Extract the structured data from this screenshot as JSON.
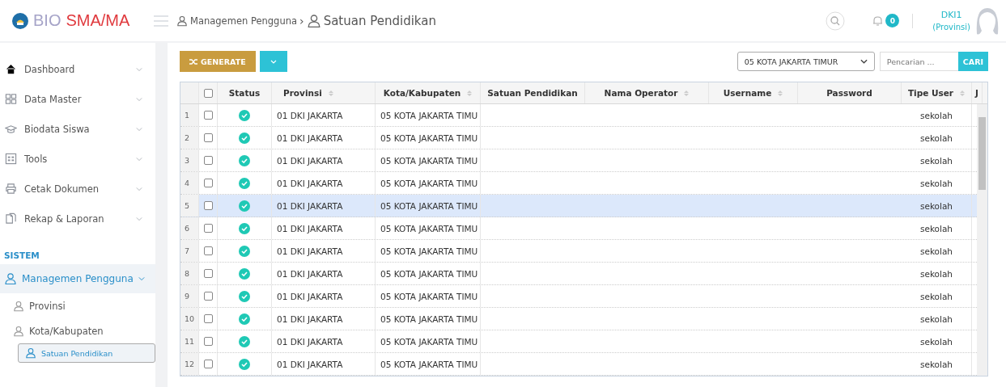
{
  "header": {
    "logo": {
      "part1": "BIO",
      "part2": "SMA/MA"
    },
    "breadcrumb": [
      {
        "label": "Managemen Pengguna"
      },
      {
        "label": "Satuan Pendidikan"
      }
    ],
    "breadcrumb_separator": "›",
    "notifications": "0",
    "user": {
      "name": "DKI1",
      "role": "(Provinsi)"
    }
  },
  "sidebar": {
    "items": [
      {
        "label": "Dashboard",
        "kind": "home"
      },
      {
        "label": "Data Master",
        "kind": "grid"
      },
      {
        "label": "Biodata Siswa",
        "kind": "cap"
      },
      {
        "label": "Tools",
        "kind": "tools"
      },
      {
        "label": "Cetak Dokumen",
        "kind": "printer"
      },
      {
        "label": "Rekap & Laporan",
        "kind": "report"
      }
    ],
    "section": "SISTEM",
    "group": {
      "label": "Managemen Pengguna",
      "expanded": true,
      "children": [
        {
          "label": "Provinsi",
          "selected": false
        },
        {
          "label": "Kota/Kabupaten",
          "selected": false
        },
        {
          "label": "Satuan Pendidikan",
          "selected": true
        }
      ]
    }
  },
  "toolbar": {
    "generate": "GENERATE",
    "filter": "05 KOTA JAKARTA TIMUR",
    "search_placeholder": "Pencarian ...",
    "search_button": "CARI"
  },
  "table": {
    "header_checked": false,
    "columns": [
      {
        "label": "Status",
        "sortable": false
      },
      {
        "label": "Provinsi",
        "sortable": true
      },
      {
        "label": "Kota/Kabupaten",
        "sortable": true
      },
      {
        "label": "Satuan Pendidikan",
        "sortable": false
      },
      {
        "label": "Nama Operator",
        "sortable": true
      },
      {
        "label": "Username",
        "sortable": true
      },
      {
        "label": "Password",
        "sortable": false
      },
      {
        "label": "Tipe User",
        "sortable": true
      },
      {
        "label": "J",
        "sortable": false
      }
    ],
    "rows": [
      {
        "number": "1",
        "checked": false,
        "active": true,
        "provinsi": "01 DKI JAKARTA",
        "kota": "05 KOTA JAKARTA TIMU",
        "tipe_user": "sekolah",
        "selected": false
      },
      {
        "number": "2",
        "checked": false,
        "active": true,
        "provinsi": "01 DKI JAKARTA",
        "kota": "05 KOTA JAKARTA TIMU",
        "tipe_user": "sekolah",
        "selected": false
      },
      {
        "number": "3",
        "checked": false,
        "active": true,
        "provinsi": "01 DKI JAKARTA",
        "kota": "05 KOTA JAKARTA TIMU",
        "tipe_user": "sekolah",
        "selected": false
      },
      {
        "number": "4",
        "checked": false,
        "active": true,
        "provinsi": "01 DKI JAKARTA",
        "kota": "05 KOTA JAKARTA TIMU",
        "tipe_user": "sekolah",
        "selected": false
      },
      {
        "number": "5",
        "checked": false,
        "active": true,
        "provinsi": "01 DKI JAKARTA",
        "kota": "05 KOTA JAKARTA TIMU",
        "tipe_user": "sekolah",
        "selected": true
      },
      {
        "number": "6",
        "checked": false,
        "active": true,
        "provinsi": "01 DKI JAKARTA",
        "kota": "05 KOTA JAKARTA TIMU",
        "tipe_user": "sekolah",
        "selected": false
      },
      {
        "number": "7",
        "checked": false,
        "active": true,
        "provinsi": "01 DKI JAKARTA",
        "kota": "05 KOTA JAKARTA TIMU",
        "tipe_user": "sekolah",
        "selected": false
      },
      {
        "number": "8",
        "checked": false,
        "active": true,
        "provinsi": "01 DKI JAKARTA",
        "kota": "05 KOTA JAKARTA TIMU",
        "tipe_user": "sekolah",
        "selected": false
      },
      {
        "number": "9",
        "checked": false,
        "active": true,
        "provinsi": "01 DKI JAKARTA",
        "kota": "05 KOTA JAKARTA TIMU",
        "tipe_user": "sekolah",
        "selected": false
      },
      {
        "number": "10",
        "checked": false,
        "active": true,
        "provinsi": "01 DKI JAKARTA",
        "kota": "05 KOTA JAKARTA TIMU",
        "tipe_user": "sekolah",
        "selected": false
      },
      {
        "number": "11",
        "checked": false,
        "active": true,
        "provinsi": "01 DKI JAKARTA",
        "kota": "05 KOTA JAKARTA TIMU",
        "tipe_user": "sekolah",
        "selected": false
      },
      {
        "number": "12",
        "checked": false,
        "active": true,
        "provinsi": "01 DKI JAKARTA",
        "kota": "05 KOTA JAKARTA TIMU",
        "tipe_user": "sekolah",
        "selected": false
      }
    ]
  }
}
